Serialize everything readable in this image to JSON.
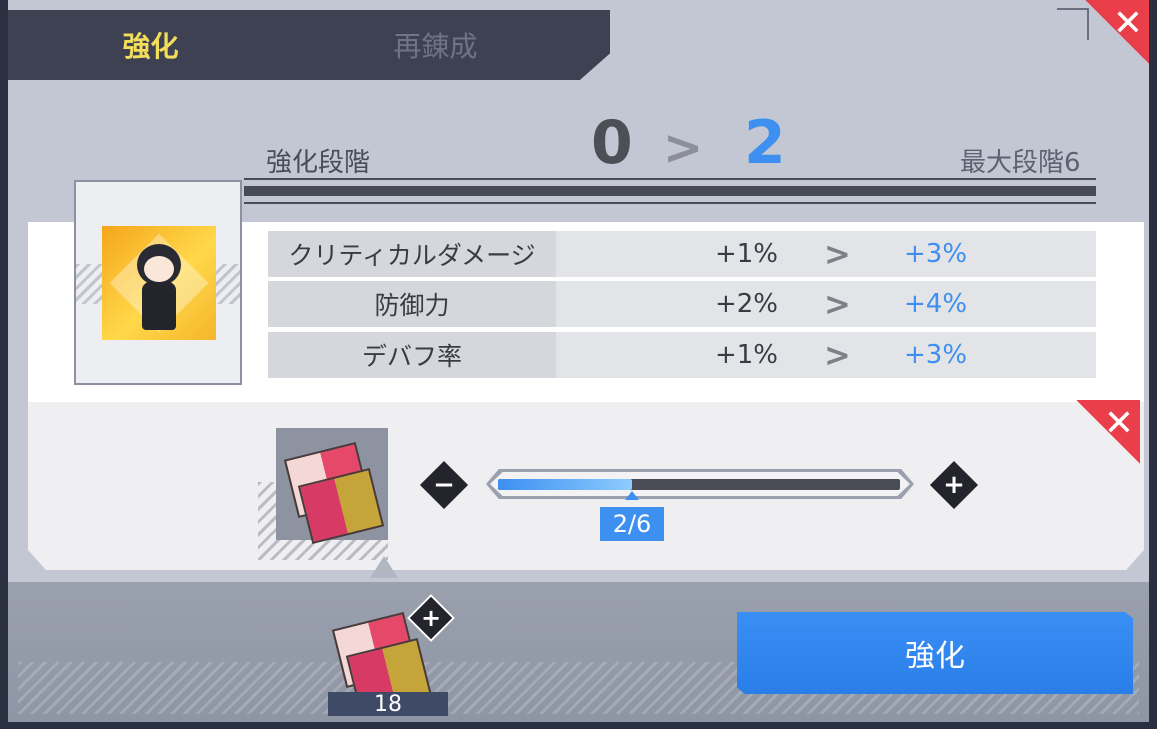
{
  "tabs": [
    {
      "label": "強化",
      "active": true
    },
    {
      "label": "再錬成",
      "active": false
    }
  ],
  "close_icon": "✕",
  "stage": {
    "label": "強化段階",
    "from": "0",
    "arrow": ">",
    "to": "2",
    "max_label": "最大段階6"
  },
  "stats": [
    {
      "name": "クリティカルダメージ",
      "current": "+1%",
      "arrow": ">",
      "next": "+3%"
    },
    {
      "name": "防御力",
      "current": "+2%",
      "arrow": ">",
      "next": "+4%"
    },
    {
      "name": "デバフ率",
      "current": "+1%",
      "arrow": ">",
      "next": "+3%"
    }
  ],
  "material": {
    "minus": "−",
    "plus": "+",
    "selected": 2,
    "max": 6,
    "value_text": "2/6",
    "icon": "fabric-material-icon"
  },
  "inventory": {
    "plus": "+",
    "count": "18"
  },
  "enhance_button": "強化",
  "colors": {
    "accent_yellow": "#f2de5a",
    "accent_blue": "#3d8ff0",
    "close_red": "#ea3e4a"
  }
}
